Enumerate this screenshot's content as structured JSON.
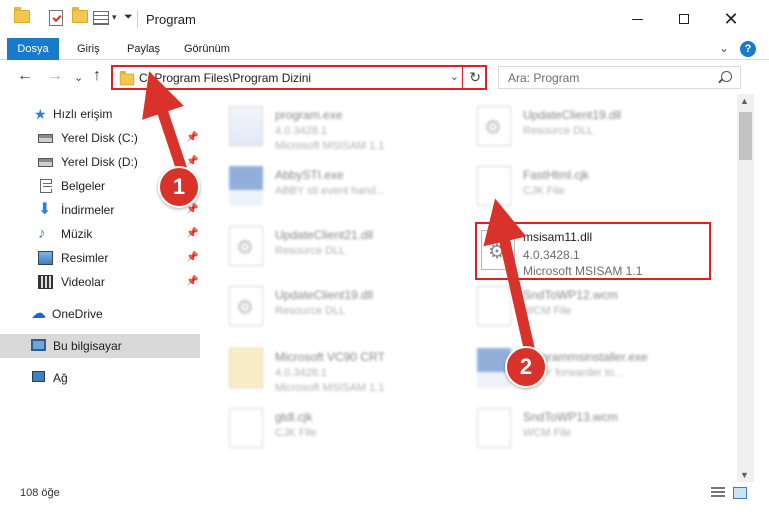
{
  "window": {
    "title": "Program",
    "minimize_icon": "minimize-icon",
    "maximize_icon": "maximize-icon",
    "close_glyph": "✕"
  },
  "quick_access_toolbar": {
    "caret_glyph": "▾",
    "icons": [
      "folder-icon",
      "properties-check-icon",
      "new-folder-icon",
      "properties-icon"
    ]
  },
  "ribbon": {
    "tabs": [
      {
        "label": "Dosya"
      },
      {
        "label": "Giriş"
      },
      {
        "label": "Paylaş"
      },
      {
        "label": "Görünüm"
      }
    ],
    "expand_glyph": "⌄",
    "help_glyph": "?"
  },
  "navigation": {
    "back_glyph": "←",
    "forward_glyph": "→",
    "recent_glyph": "⌄",
    "up_glyph": "↑",
    "address_path": "C:\\Program Files\\Program Dizini",
    "address_dropdown_glyph": "⌄",
    "refresh_glyph": "↻",
    "search_placeholder": "Ara: Program"
  },
  "sidebar": {
    "items": [
      {
        "label": "Hızlı erişim",
        "icon": "star-icon"
      },
      {
        "label": "Yerel Disk (C:)",
        "icon": "drive-icon",
        "pinned": true
      },
      {
        "label": "Yerel Disk (D:)",
        "icon": "drive-icon",
        "pinned": true
      },
      {
        "label": "Belgeler",
        "icon": "documents-icon",
        "pinned": true
      },
      {
        "label": "İndirmeler",
        "icon": "downloads-icon",
        "pinned": true
      },
      {
        "label": "Müzik",
        "icon": "music-icon",
        "pinned": true
      },
      {
        "label": "Resimler",
        "icon": "pictures-icon",
        "pinned": true
      },
      {
        "label": "Videolar",
        "icon": "videos-icon",
        "pinned": true
      },
      {
        "label": "OneDrive",
        "icon": "cloud-icon"
      },
      {
        "label": "Bu bilgisayar",
        "icon": "computer-icon",
        "selected": true
      },
      {
        "label": "Ağ",
        "icon": "network-icon"
      }
    ],
    "pin_glyph": "📌"
  },
  "files": [
    {
      "name": "program.exe",
      "line2": "4.0.3428.1",
      "line3": "Microsoft MSISAM 1.1",
      "icon": "setup-icon"
    },
    {
      "name": "UpdateClient19.dll",
      "line2": "Resource DLL",
      "line3": "",
      "icon": "dll-gear-icon"
    },
    {
      "name": "AbbySTI.exe",
      "line2": "ABBY sti event hand...",
      "line3": "",
      "icon": "app-icon"
    },
    {
      "name": "FastHtml.cjk",
      "line2": "CJK File",
      "line3": "",
      "icon": "blank-file-icon"
    },
    {
      "name": "UpdateClient21.dll",
      "line2": "Resource DLL",
      "line3": "",
      "icon": "dll-gear-icon"
    },
    {
      "name": "msisam11.dll",
      "line2": "4.0.3428.1",
      "line3": "Microsoft MSISAM 1.1",
      "icon": "dll-gear-icon",
      "highlighted": true
    },
    {
      "name": "UpdateClient19.dll",
      "line2": "Resource DLL",
      "line3": "",
      "icon": "dll-gear-icon"
    },
    {
      "name": "SndToWP12.wcm",
      "line2": "WCM File",
      "line3": "",
      "icon": "blank-file-icon"
    },
    {
      "name": "Microsoft VC90 CRT",
      "line2": "4.0.3428.1",
      "line3": "Microsoft MSISAM 1.1",
      "icon": "package-icon"
    },
    {
      "name": "Diagrammsinstaller.exe",
      "line2": "ABBY forwarder to...",
      "line3": "",
      "icon": "app-icon"
    },
    {
      "name": "gtdl.cjk",
      "line2": "CJK File",
      "line3": "",
      "icon": "blank-file-icon"
    },
    {
      "name": "SndToWP13.wcm",
      "line2": "WCM File",
      "line3": "",
      "icon": "blank-file-icon"
    }
  ],
  "status": {
    "item_count": "108 öğe"
  },
  "scrollbar": {
    "up_glyph": "▲",
    "down_glyph": "▼"
  },
  "annotations": {
    "step1": "1",
    "step2": "2",
    "color": "#d9322b"
  },
  "colors": {
    "accent": "#1979ca",
    "highlight_border": "#e02020",
    "selected_bg": "#d9d9d9"
  }
}
